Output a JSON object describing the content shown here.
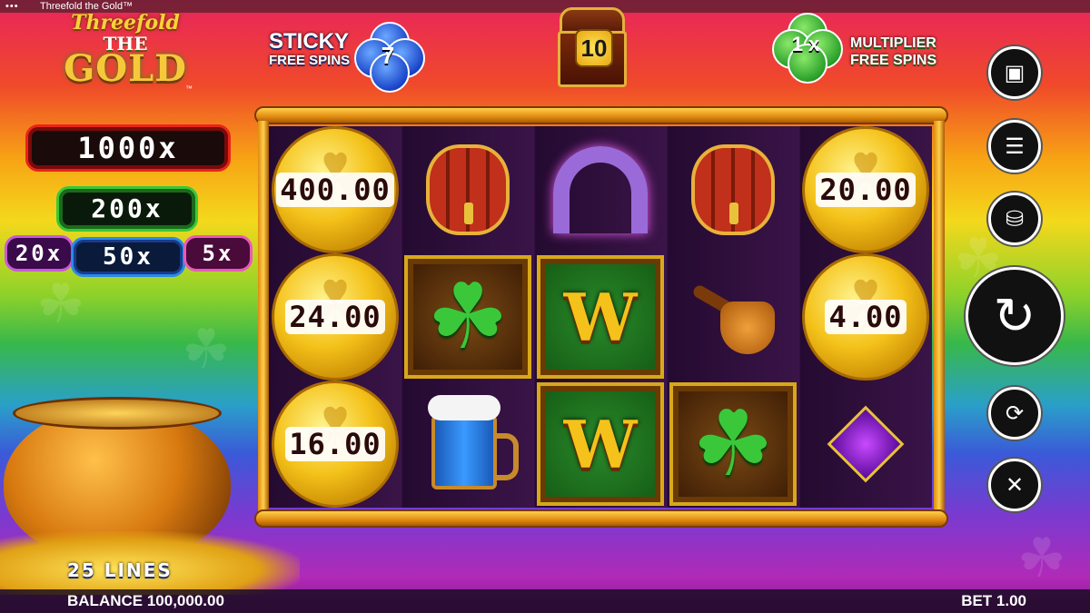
{
  "window": {
    "title": "Threefold the Gold™",
    "menu_dots": "•••"
  },
  "logo": {
    "line1": "Threefold",
    "line2": "THE",
    "line3": "GOLD",
    "tm": "™"
  },
  "features": {
    "sticky": {
      "line1": "STICKY",
      "line2": "FREE SPINS",
      "count": "7"
    },
    "chest": {
      "count": "10"
    },
    "multiplier": {
      "value": "1 x",
      "line1": "MULTIPLIER",
      "line2": "FREE SPINS"
    }
  },
  "jackpots": {
    "j1000": "1000x",
    "j200": "200x",
    "j20": "20x",
    "j50": "50x",
    "j5": "5x"
  },
  "lines_label": "25 LINES",
  "reels": [
    [
      {
        "type": "coin",
        "value": "400.00"
      },
      {
        "type": "coin",
        "value": "24.00"
      },
      {
        "type": "coin",
        "value": "16.00"
      }
    ],
    [
      {
        "type": "barrel"
      },
      {
        "type": "clover"
      },
      {
        "type": "mug"
      }
    ],
    [
      {
        "type": "horseshoe"
      },
      {
        "type": "wild",
        "label": "W"
      },
      {
        "type": "wild",
        "label": "W"
      }
    ],
    [
      {
        "type": "barrel"
      },
      {
        "type": "pipe"
      },
      {
        "type": "clover"
      }
    ],
    [
      {
        "type": "coin",
        "value": "20.00"
      },
      {
        "type": "coin",
        "value": "4.00"
      },
      {
        "type": "diamond"
      }
    ]
  ],
  "buttons": {
    "video": "video-icon",
    "menu": "menu-icon",
    "coins": "coin-stack-icon",
    "spin": "spin-icon",
    "autoplay": "autoplay-icon",
    "turbo": "turbo-icon"
  },
  "status": {
    "balance": "BALANCE 100,000.00",
    "bet": "BET 1.00"
  },
  "colors": {
    "jackpot_red": "#e8241a",
    "jackpot_green": "#3ac83a",
    "jackpot_blue": "#2a8ae8",
    "jackpot_purple": "#c85ad8",
    "jackpot_pink": "#e85ab8"
  }
}
